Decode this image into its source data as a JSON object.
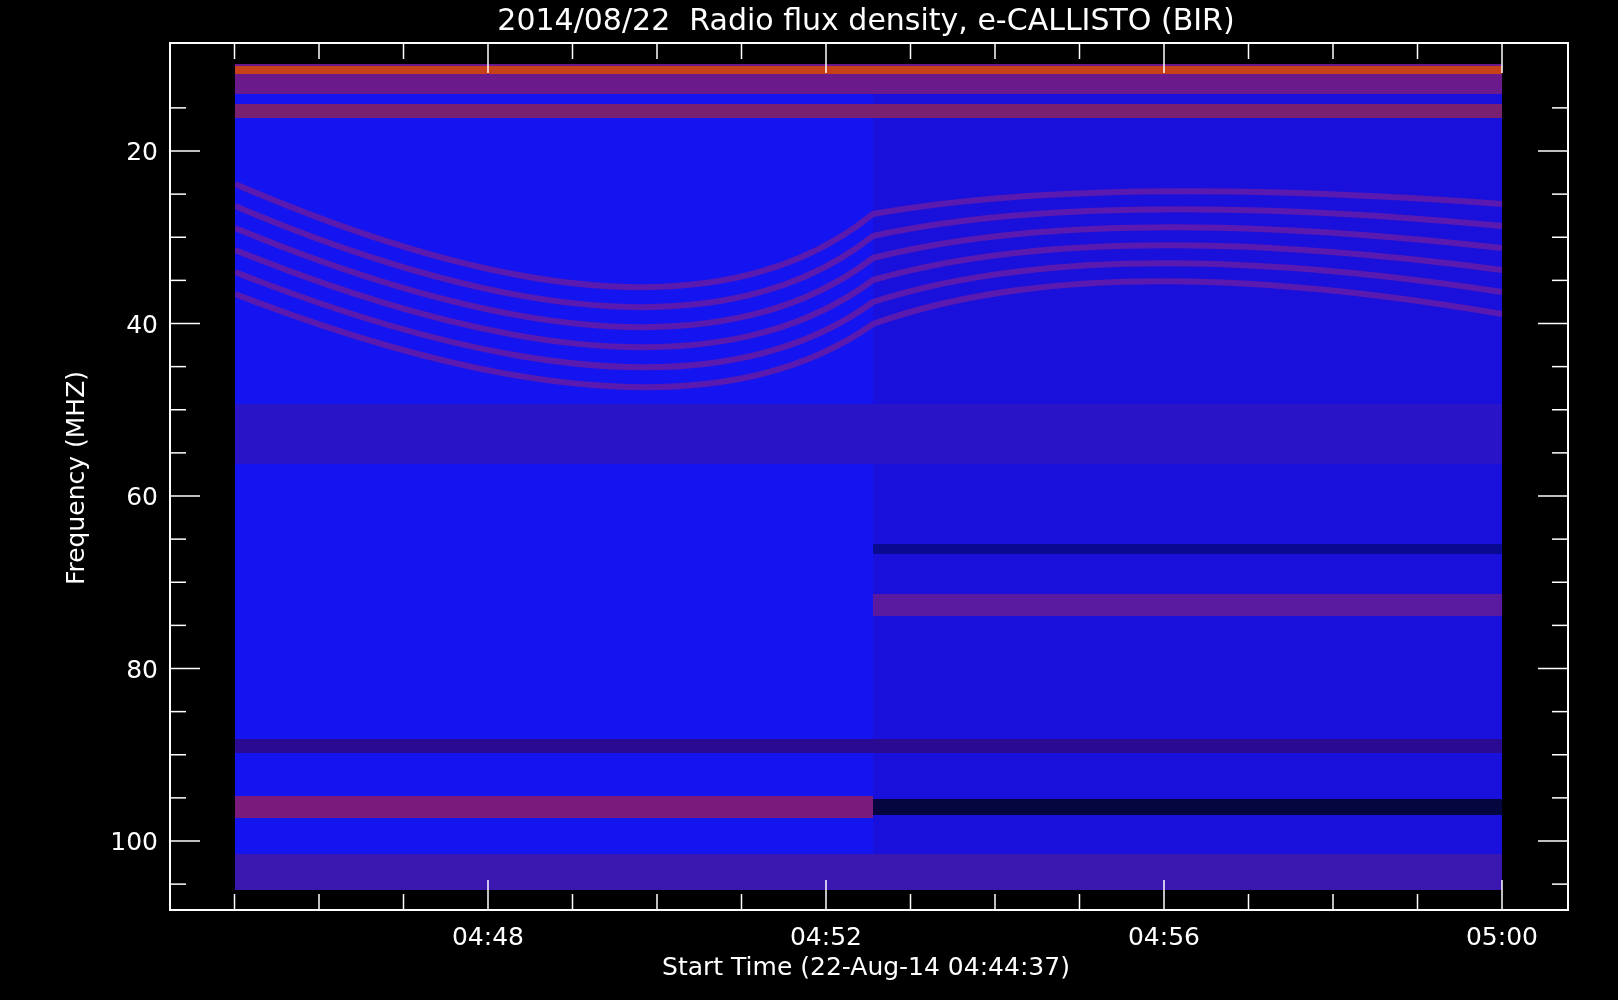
{
  "title": "2014/08/22  Radio flux density, e-CALLISTO (BIR)",
  "y_axis": {
    "label": "Frequency (MHZ)",
    "ticks": [
      "20",
      "40",
      "60",
      "80",
      "100"
    ]
  },
  "x_axis": {
    "label": "Start Time (22-Aug-14 04:44:37)",
    "ticks": [
      "04:48",
      "04:52",
      "04:56",
      "05:00"
    ]
  }
}
